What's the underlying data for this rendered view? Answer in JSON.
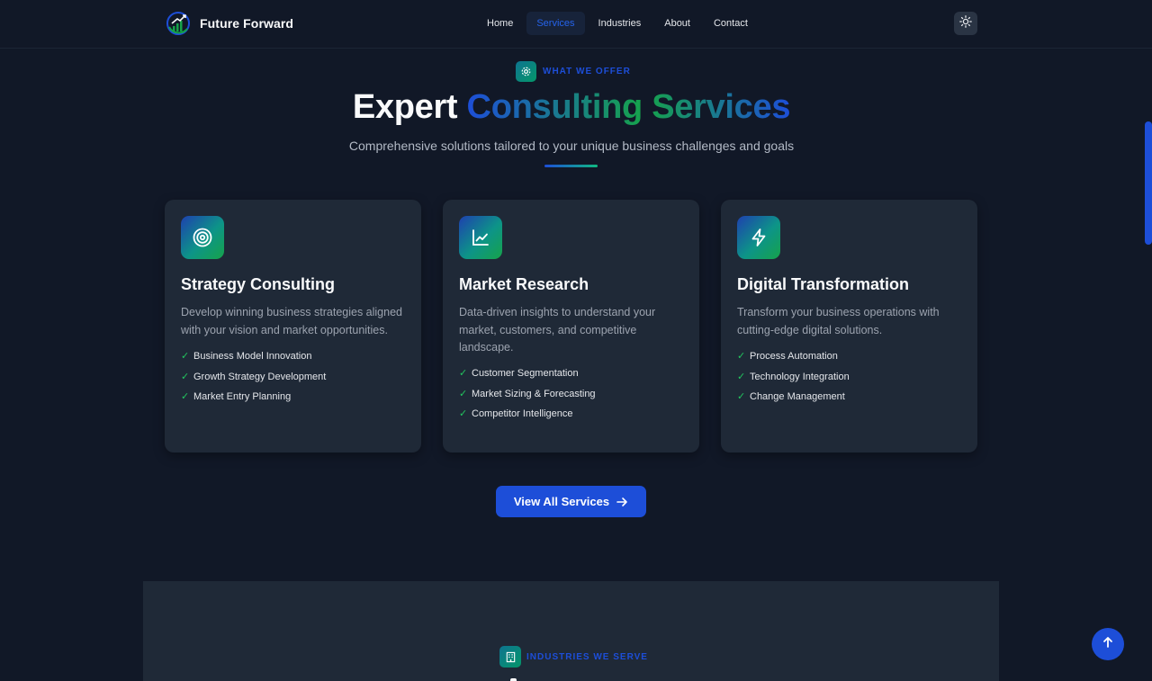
{
  "brand": {
    "name": "Future Forward",
    "logo_icon": "growth-chart-logo-icon"
  },
  "nav": {
    "items": [
      {
        "label": "Home",
        "active": false
      },
      {
        "label": "Services",
        "active": true
      },
      {
        "label": "Industries",
        "active": false
      },
      {
        "label": "About",
        "active": false
      },
      {
        "label": "Contact",
        "active": false
      }
    ],
    "theme_toggle_icon": "sun-icon"
  },
  "hero": {
    "eyebrow": "WHAT WE OFFER",
    "eyebrow_icon": "gear-icon",
    "title_plain": "Expert",
    "title_highlight": "Consulting Services",
    "subtitle": "Comprehensive solutions tailored to your unique business challenges and goals"
  },
  "cards": [
    {
      "icon": "target-icon",
      "title": "Strategy Consulting",
      "description": "Develop winning business strategies aligned with your vision and market opportunities.",
      "features": [
        "Business Model Innovation",
        "Growth Strategy Development",
        "Market Entry Planning"
      ]
    },
    {
      "icon": "line-chart-icon",
      "title": "Market Research",
      "description": "Data-driven insights to understand your market, customers, and competitive landscape.",
      "features": [
        "Customer Segmentation",
        "Market Sizing & Forecasting",
        "Competitor Intelligence"
      ]
    },
    {
      "icon": "lightning-bolt-icon",
      "title": "Digital Transformation",
      "description": "Transform your business operations with cutting-edge digital solutions.",
      "features": [
        "Process Automation",
        "Technology Integration",
        "Change Management"
      ]
    }
  ],
  "check_glyph": "✓",
  "cta": {
    "label": "View All Services",
    "icon": "arrow-right-icon"
  },
  "industries": {
    "eyebrow": "INDUSTRIES WE SERVE",
    "eyebrow_icon": "building-icon"
  },
  "back_to_top_icon": "arrow-up-icon",
  "colors": {
    "background": "#111827",
    "card": "#1f2937",
    "accent_blue": "#1d4ed8",
    "accent_green": "#16a34a",
    "check_green": "#22c55e"
  }
}
